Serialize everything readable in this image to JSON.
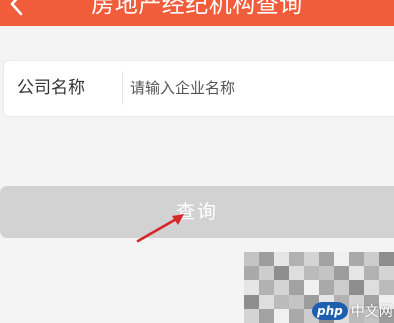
{
  "header": {
    "title": "房地产经纪机构查询",
    "back_icon": "chevron-left-icon",
    "background_color": "#f15d3a"
  },
  "form": {
    "company_label": "公司名称",
    "company_placeholder": "请输入企业名称",
    "company_value": ""
  },
  "actions": {
    "query_label": "查询",
    "query_color": "#d2d2d2"
  },
  "annotation": {
    "arrow_color": "#d6262a",
    "arrow_icon": "arrow-annotation-icon"
  },
  "watermark": {
    "brand": "php",
    "site": "中文网"
  }
}
